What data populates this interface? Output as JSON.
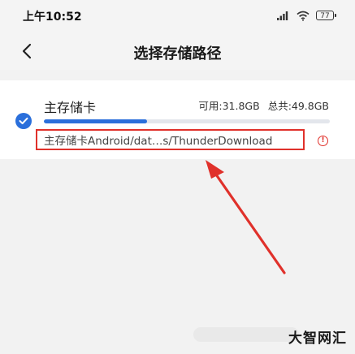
{
  "status_bar": {
    "time": "上午10:52",
    "battery": "77"
  },
  "header": {
    "title": "选择存储路径"
  },
  "storage": {
    "name": "主存储卡",
    "available": "可用:31.8GB",
    "total": "总共:49.8GB",
    "used_fraction": 0.36,
    "path": "主存储卡Android/dat…s/ThunderDownload",
    "selected": true
  },
  "colors": {
    "accent": "#2a6fdb",
    "highlight": "#e0312b"
  },
  "watermark": "大智网汇"
}
